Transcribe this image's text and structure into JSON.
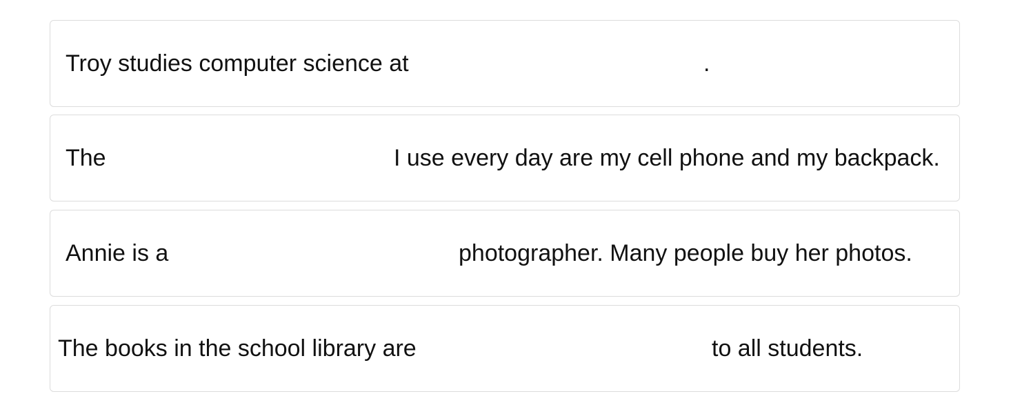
{
  "sentences": [
    {
      "before": "Troy studies computer science at",
      "blank_value": "",
      "after": "."
    },
    {
      "before": "The",
      "blank_value": "",
      "after": "I use every day are my cell phone and my backpack."
    },
    {
      "before": "Annie is a",
      "blank_value": "",
      "after": "photographer. Many people buy her photos."
    },
    {
      "before": "The books in the school library are",
      "blank_value": "",
      "after": "to all students."
    }
  ]
}
